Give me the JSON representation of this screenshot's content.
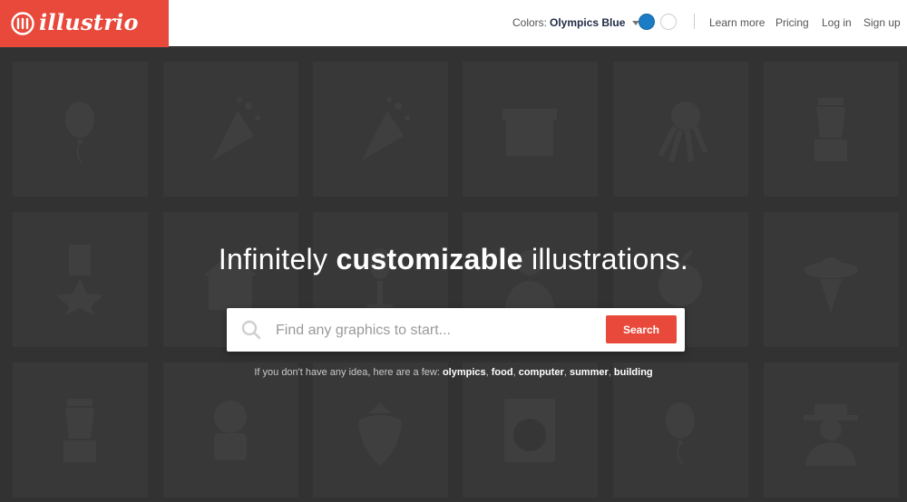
{
  "brand": {
    "name": "illustrio",
    "color": "#e8493a"
  },
  "header": {
    "colors_label": "Colors:",
    "colors_value": "Olympics Blue",
    "swatches": [
      "#1b7cc6",
      "#ffffff"
    ],
    "nav": {
      "learn_more": "Learn more",
      "pricing": "Pricing",
      "login": "Log in",
      "signup": "Sign up"
    }
  },
  "hero": {
    "title_pre": "Infinitely ",
    "title_bold": "customizable",
    "title_post": " illustrations.",
    "search_placeholder": "Find any graphics to start...",
    "search_button": "Search",
    "suggest_text": "If you don't have any idea, here are a few: ",
    "suggestions": [
      "olympics",
      "food",
      "computer",
      "summer",
      "building"
    ]
  },
  "tiles": [
    "balloon-icon",
    "party-popper-icon",
    "party-popper-icon",
    "storefront-icon",
    "octopus-icon",
    "blender-icon",
    "medal-icon",
    "house-icon",
    "microphone-icon",
    "person-icon",
    "apple-icon",
    "ufo-icon",
    "blender-icon",
    "astronaut-icon",
    "strawberry-icon",
    "washing-machine-icon",
    "balloon-icon",
    "detective-icon"
  ]
}
